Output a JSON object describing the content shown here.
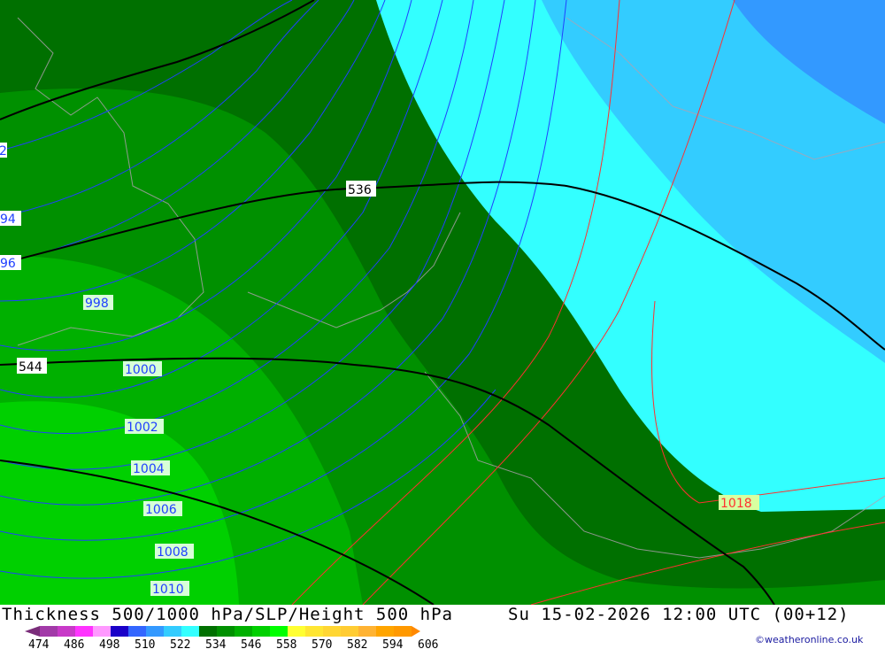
{
  "map": {
    "fill_colors": {
      "dark_green": "#007000",
      "mid_green": "#009000",
      "green": "#00b000",
      "light_green": "#00d000",
      "cyan": "#33ffff",
      "sky": "#33ccff",
      "blue": "#3399ff"
    },
    "thickness_labels": [
      "536",
      "544"
    ],
    "pressure_labels": [
      "998",
      "1000",
      "1002",
      "1004",
      "1006",
      "1008",
      "1010",
      "1018"
    ],
    "edge_labels": [
      "2",
      "94",
      "96"
    ]
  },
  "footer": {
    "title": "Thickness 500/1000 hPa/SLP/Height 500 hPa",
    "datetime": "Su 15-02-2026 12:00 UTC (00+12)",
    "credit": "©weatheronline.co.uk",
    "colorbar": {
      "colors": [
        "#a23aa8",
        "#c83ac8",
        "#ff33ff",
        "#ff99ff",
        "#1a00c8",
        "#3366ff",
        "#3399ff",
        "#33ccff",
        "#33ffff",
        "#007000",
        "#009000",
        "#00b000",
        "#00d000",
        "#00ff00",
        "#ffff33",
        "#ffe633",
        "#ffd633",
        "#ffcc33",
        "#ffb333",
        "#ffa500",
        "#ff9900"
      ],
      "left_arrow_color": "#7a2d7a",
      "right_arrow_color": "#ff8800",
      "ticks": [
        "474",
        "486",
        "498",
        "510",
        "522",
        "534",
        "546",
        "558",
        "570",
        "582",
        "594",
        "606"
      ]
    }
  }
}
